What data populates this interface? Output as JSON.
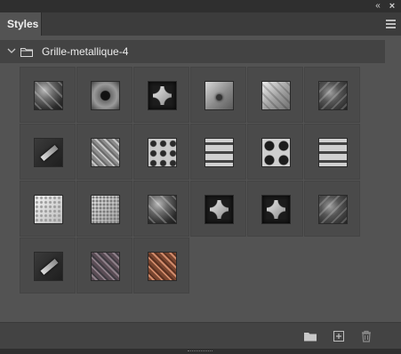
{
  "panel": {
    "tab_label": "Styles",
    "collapse_glyph": "«",
    "close_glyph": "×"
  },
  "group": {
    "name": "Grille-metallique-4",
    "expanded": true
  },
  "styles": [
    {
      "icon": "dark-diagonal-grille"
    },
    {
      "icon": "center-hole-plate"
    },
    {
      "icon": "cross-cut-plate"
    },
    {
      "icon": "riveted-steel"
    },
    {
      "icon": "brushed-diagonal-plate"
    },
    {
      "icon": "dark-shard-grille"
    },
    {
      "icon": "z-bracket"
    },
    {
      "icon": "diamond-tread"
    },
    {
      "icon": "punched-dots"
    },
    {
      "icon": "slotted-plate"
    },
    {
      "icon": "large-holes"
    },
    {
      "icon": "slotted-plate-light"
    },
    {
      "icon": "fine-perforated"
    },
    {
      "icon": "micro-perforated"
    },
    {
      "icon": "dark-diagonal-grille-2"
    },
    {
      "icon": "cross-cut-plate-2"
    },
    {
      "icon": "cross-cut-dark"
    },
    {
      "icon": "dark-shard-grille-2"
    },
    {
      "icon": "z-bracket-2"
    },
    {
      "icon": "colored-diamond-tread"
    },
    {
      "icon": "copper-diamond-tread"
    }
  ],
  "toolbar": {
    "new_group_icon": "folder-icon",
    "new_style_icon": "plus-square-icon",
    "delete_icon": "trash-icon"
  },
  "colors": {
    "panel_bg": "#535353",
    "header_bg": "#434343",
    "text": "#ececec"
  }
}
